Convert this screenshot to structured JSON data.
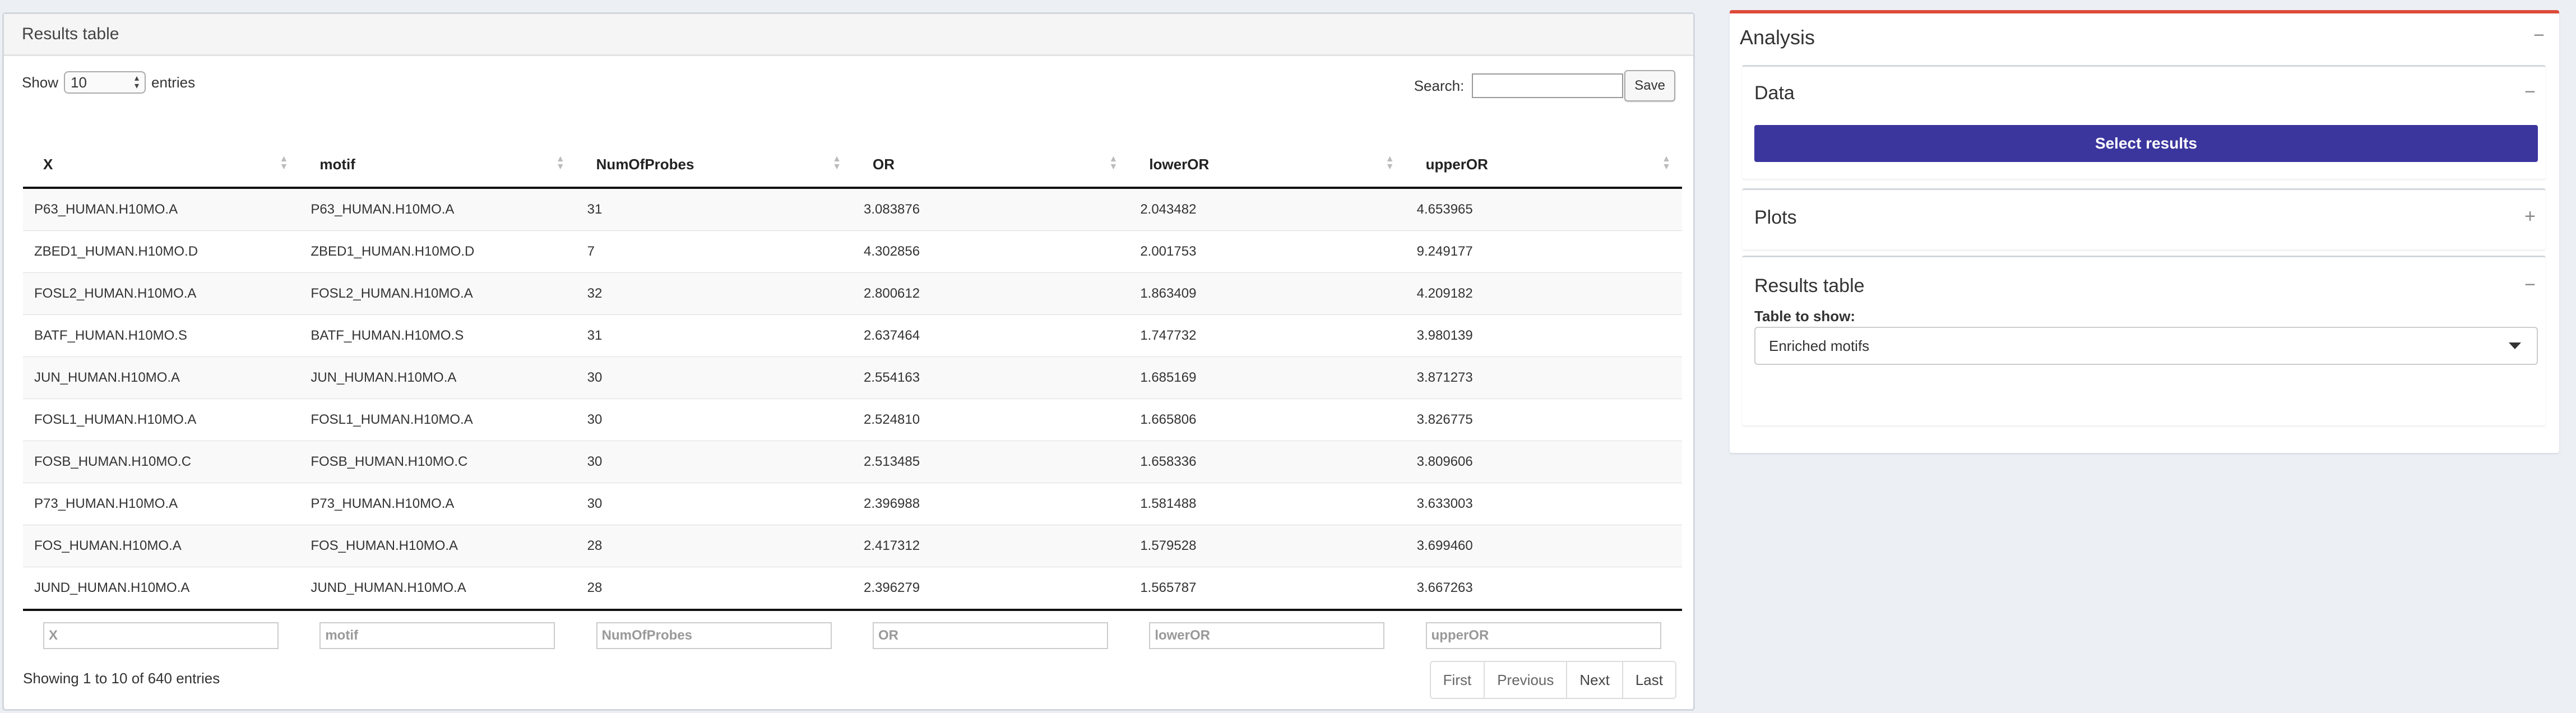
{
  "left_panel": {
    "title": "Results table",
    "length": {
      "show_label": "Show",
      "value": "10",
      "entries_label": "entries"
    },
    "search": {
      "label": "Search:",
      "value": "",
      "save_label": "Save"
    },
    "table": {
      "columns": [
        "X",
        "motif",
        "NumOfProbes",
        "OR",
        "lowerOR",
        "upperOR"
      ],
      "rows": [
        [
          "P63_HUMAN.H10MO.A",
          "P63_HUMAN.H10MO.A",
          "31",
          "3.083876",
          "2.043482",
          "4.653965"
        ],
        [
          "ZBED1_HUMAN.H10MO.D",
          "ZBED1_HUMAN.H10MO.D",
          "7",
          "4.302856",
          "2.001753",
          "9.249177"
        ],
        [
          "FOSL2_HUMAN.H10MO.A",
          "FOSL2_HUMAN.H10MO.A",
          "32",
          "2.800612",
          "1.863409",
          "4.209182"
        ],
        [
          "BATF_HUMAN.H10MO.S",
          "BATF_HUMAN.H10MO.S",
          "31",
          "2.637464",
          "1.747732",
          "3.980139"
        ],
        [
          "JUN_HUMAN.H10MO.A",
          "JUN_HUMAN.H10MO.A",
          "30",
          "2.554163",
          "1.685169",
          "3.871273"
        ],
        [
          "FOSL1_HUMAN.H10MO.A",
          "FOSL1_HUMAN.H10MO.A",
          "30",
          "2.524810",
          "1.665806",
          "3.826775"
        ],
        [
          "FOSB_HUMAN.H10MO.C",
          "FOSB_HUMAN.H10MO.C",
          "30",
          "2.513485",
          "1.658336",
          "3.809606"
        ],
        [
          "P73_HUMAN.H10MO.A",
          "P73_HUMAN.H10MO.A",
          "30",
          "2.396988",
          "1.581488",
          "3.633003"
        ],
        [
          "FOS_HUMAN.H10MO.A",
          "FOS_HUMAN.H10MO.A",
          "28",
          "2.417312",
          "1.579528",
          "3.699460"
        ],
        [
          "JUND_HUMAN.H10MO.A",
          "JUND_HUMAN.H10MO.A",
          "28",
          "2.396279",
          "1.565787",
          "3.667263"
        ]
      ],
      "footer_placeholders": [
        "X",
        "motif",
        "NumOfProbes",
        "OR",
        "lowerOR",
        "upperOR"
      ]
    },
    "info": "Showing 1 to 10 of 640 entries",
    "pagination": {
      "first": "First",
      "previous": "Previous",
      "next": "Next",
      "last": "Last"
    }
  },
  "right_panel": {
    "title": "Analysis",
    "collapse_icon": "minus-icon",
    "data_box": {
      "title": "Data",
      "button_label": "Select results"
    },
    "plots_box": {
      "title": "Plots",
      "expand_icon": "plus-icon"
    },
    "results_box": {
      "title": "Results table",
      "table_to_show_label": "Table to show:",
      "selected": "Enriched motifs"
    },
    "accent_color": "#dd4b39",
    "button_color": "#3b369e"
  }
}
